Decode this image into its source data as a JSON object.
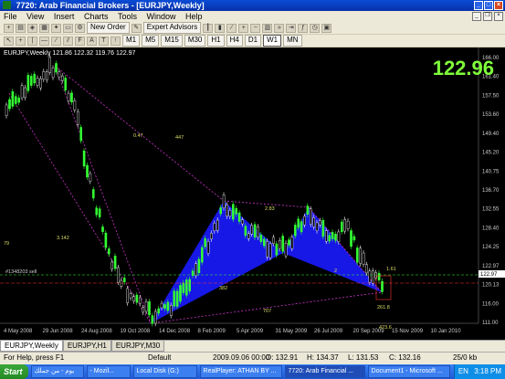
{
  "window": {
    "title": "7720: Arab Financial Brokers - [EURJPY,Weekly]"
  },
  "menu": [
    "File",
    "View",
    "Insert",
    "Charts",
    "Tools",
    "Window",
    "Help"
  ],
  "toolbar": {
    "new_order": "New Order",
    "expert_advisors": "Expert Advisors"
  },
  "timeframes": [
    "M1",
    "M5",
    "M15",
    "M30",
    "H1",
    "H4",
    "D1",
    "W1",
    "MN"
  ],
  "active_timeframe": "W1",
  "chart": {
    "symbol_info": "EURJPY,Weekly  121.86 122.32 119.76 122.97",
    "big_price": "122.96",
    "price_labels": [
      "166.00",
      "161.40",
      "157.50",
      "153.60",
      "149.40",
      "145.20",
      "140.75",
      "136.70",
      "132.55",
      "128.40",
      "124.25",
      "122.97",
      "120.13",
      "116.00",
      "111.00"
    ],
    "time_labels": [
      "4 May 2008",
      "29 Jun 2008",
      "24 Aug 2008",
      "19 Oct 2008",
      "14 Dec 2008",
      "8 Feb 2009",
      "5 Apr 2009",
      "31 May 2009",
      "26 Jul 2009",
      "20 Sep 2009",
      "15 Nov 2009",
      "10 Jan 2010"
    ],
    "hline_label": "#1348203 sell",
    "annotations": [
      "0.47",
      "447",
      "3.142",
      "2.83",
      "382",
      "707",
      "2",
      "1.61",
      "79",
      "261.8",
      "423.6"
    ],
    "colors": {
      "pattern": "#1a1aff",
      "bull": "#33ff33",
      "line": "#cc33cc",
      "sell": "#ff3333"
    }
  },
  "tabs": [
    "EURJPY,Weekly",
    "EURJPY,H1",
    "EURJPY,M30"
  ],
  "status": {
    "help": "For Help, press F1",
    "profile": "Default",
    "datetime": "2009.09.06 00:00",
    "open": "O: 132.91",
    "high": "H: 134.37",
    "low": "L: 131.53",
    "close": "C: 132.16",
    "traffic": "25/0 kb"
  },
  "taskbar": {
    "start": "Start",
    "tasks": [
      "يوم - من جملك",
      "- Mozil...",
      "Local Disk (G:)",
      "RealPlayer: ATHAN BY ...",
      "7720: Arab Financial ...",
      "Document1 - Microsoft ..."
    ],
    "lang": "EN",
    "time": "3:18 PM"
  }
}
